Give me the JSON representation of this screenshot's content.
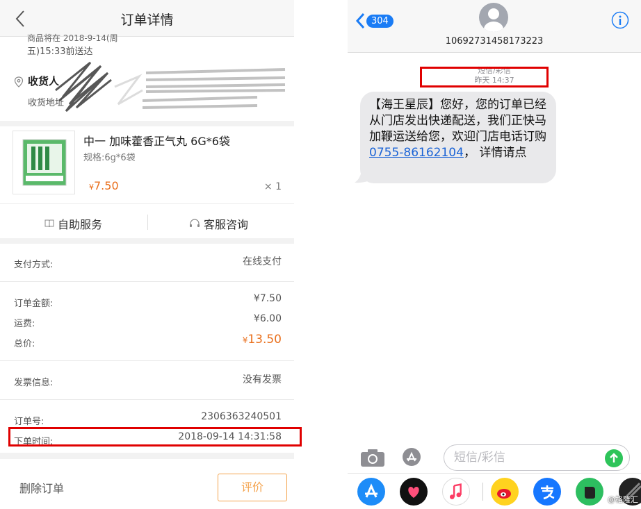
{
  "left": {
    "header": {
      "title": "订单详情"
    },
    "address": {
      "cut_line": "商品将在 2018-9-14(周",
      "deliver_line": "五)15:33前送达",
      "receiver_label": "收货人",
      "address_label": "收货地址"
    },
    "product": {
      "name": "中一 加味藿香正气丸 6G*6袋",
      "spec": "规格:6g*6袋",
      "price_currency": "¥",
      "price": "7.50",
      "qty": "× 1"
    },
    "service": {
      "self_service": "自助服务",
      "customer_service": "客服咨询"
    },
    "payment": {
      "label": "支付方式:",
      "value": "在线支付"
    },
    "amounts": {
      "order_amount_label": "订单金额:",
      "order_amount": "¥7.50",
      "shipping_label": "运费:",
      "shipping": "¥6.00",
      "total_label": "总价:",
      "total_currency": "¥",
      "total": "13.50"
    },
    "invoice": {
      "label": "发票信息:",
      "value": "没有发票"
    },
    "order": {
      "number_label": "订单号:",
      "number": "2306363240501",
      "time_label": "下单时间:",
      "time": "2018-09-14 14:31:58"
    },
    "footer": {
      "delete": "删除订单",
      "review": "评价"
    }
  },
  "right": {
    "header": {
      "back_count": "304",
      "phone_number": "10692731458173223"
    },
    "meta": {
      "type": "短信/彩信",
      "time": "昨天 14:37"
    },
    "message": {
      "text": "【海王星辰】您好，您的订单已经从门店发出快递配送，我们正快马加鞭运送给您，欢迎门店电话订购",
      "phone_link": "0755-86162104",
      "tail": "， 详情请点"
    },
    "input": {
      "placeholder": "短信/彩信"
    },
    "watermark": "@格隆汇"
  },
  "colors": {
    "accent_orange": "#e96f1c",
    "ios_blue": "#1a7cf5",
    "highlight_red": "#e00000",
    "send_green": "#2ec45a"
  },
  "icons": [
    "chevron-left-icon",
    "location-pin-icon",
    "book-icon",
    "headset-icon",
    "camera-icon",
    "app-store-icon",
    "info-icon",
    "send-arrow-icon"
  ]
}
